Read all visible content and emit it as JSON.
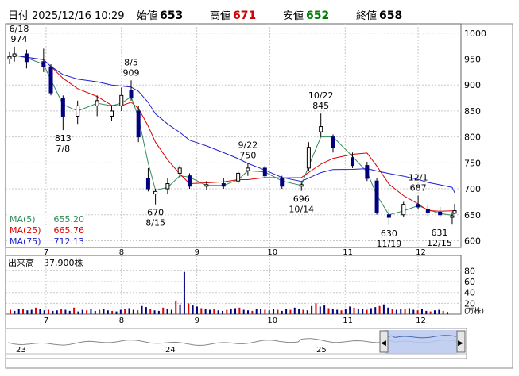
{
  "header": {
    "date_label": "日付",
    "datetime": "2025/12/16 10:29",
    "open_label": "始値",
    "open": "653",
    "high_label": "高値",
    "high": "671",
    "low_label": "安値",
    "low": "652",
    "close_label": "終値",
    "close": "658",
    "high_color": "#cc0000",
    "low_color": "#008000"
  },
  "price_panel": {
    "y_ticks": [
      "1000",
      "950",
      "900",
      "850",
      "800",
      "750",
      "700",
      "650",
      "600"
    ],
    "x_months": [
      "7",
      "8",
      "9",
      "10",
      "11",
      "12"
    ],
    "annotations": [
      {
        "date": "6/18",
        "value": "974"
      },
      {
        "date": "8/5",
        "value": "909"
      },
      {
        "date": "7/8",
        "value": "813"
      },
      {
        "date": "9/22",
        "value": "750"
      },
      {
        "date": "10/22",
        "value": "845"
      },
      {
        "date": "8/15",
        "value": "670"
      },
      {
        "date": "10/14",
        "value": "696"
      },
      {
        "date": "12/1",
        "value": "687"
      },
      {
        "date": "11/19",
        "value": "630"
      },
      {
        "date": "12/15",
        "value": "631"
      }
    ],
    "legend": [
      {
        "label": "MA(5)",
        "value": "655.20",
        "color": "#2e8b57"
      },
      {
        "label": "MA(25)",
        "value": "665.76",
        "color": "#e00000"
      },
      {
        "label": "MA(75)",
        "value": "712.13",
        "color": "#2020d0"
      }
    ]
  },
  "volume_panel": {
    "label": "出来高",
    "value": "37,900株",
    "y_ticks": [
      "80",
      "60",
      "40",
      "20"
    ],
    "unit": "(万株)"
  },
  "navigator": {
    "labels": [
      "23",
      "24",
      "25"
    ]
  },
  "colors": {
    "up_candle": "#ffffff",
    "down_candle": "#000080",
    "vol_up": "#e00000",
    "vol_down": "#000080",
    "grid": "#c8c8c8",
    "nav_fill": "#b8c8f0"
  },
  "chart_data": [
    {
      "type": "candlestick",
      "ylim": [
        590,
        1015
      ],
      "x_range": [
        "2025-06-16",
        "2025-12-16"
      ],
      "ohlc_weekly_approx": [
        {
          "d": "06-16",
          "o": 950,
          "h": 965,
          "l": 940,
          "c": 955
        },
        {
          "d": "06-18",
          "o": 955,
          "h": 974,
          "l": 945,
          "c": 960
        },
        {
          "d": "06-23",
          "o": 960,
          "h": 968,
          "l": 932,
          "c": 945
        },
        {
          "d": "06-30",
          "o": 945,
          "h": 970,
          "l": 925,
          "c": 935
        },
        {
          "d": "07-03",
          "o": 935,
          "h": 940,
          "l": 880,
          "c": 885
        },
        {
          "d": "07-08",
          "o": 875,
          "h": 880,
          "l": 813,
          "c": 840
        },
        {
          "d": "07-14",
          "o": 840,
          "h": 870,
          "l": 825,
          "c": 860
        },
        {
          "d": "07-22",
          "o": 860,
          "h": 880,
          "l": 840,
          "c": 870
        },
        {
          "d": "07-28",
          "o": 840,
          "h": 860,
          "l": 830,
          "c": 850
        },
        {
          "d": "08-01",
          "o": 860,
          "h": 895,
          "l": 850,
          "c": 880
        },
        {
          "d": "08-05",
          "o": 890,
          "h": 909,
          "l": 870,
          "c": 875
        },
        {
          "d": "08-08",
          "o": 850,
          "h": 860,
          "l": 790,
          "c": 800
        },
        {
          "d": "08-12",
          "o": 720,
          "h": 740,
          "l": 695,
          "c": 700
        },
        {
          "d": "08-15",
          "o": 690,
          "h": 700,
          "l": 670,
          "c": 695
        },
        {
          "d": "08-20",
          "o": 700,
          "h": 720,
          "l": 690,
          "c": 710
        },
        {
          "d": "08-25",
          "o": 730,
          "h": 745,
          "l": 720,
          "c": 740
        },
        {
          "d": "08-29",
          "o": 725,
          "h": 730,
          "l": 700,
          "c": 705
        },
        {
          "d": "09-05",
          "o": 705,
          "h": 715,
          "l": 698,
          "c": 708
        },
        {
          "d": "09-12",
          "o": 710,
          "h": 720,
          "l": 700,
          "c": 705
        },
        {
          "d": "09-18",
          "o": 715,
          "h": 735,
          "l": 710,
          "c": 730
        },
        {
          "d": "09-22",
          "o": 735,
          "h": 750,
          "l": 725,
          "c": 740
        },
        {
          "d": "09-29",
          "o": 740,
          "h": 745,
          "l": 720,
          "c": 725
        },
        {
          "d": "10-06",
          "o": 720,
          "h": 725,
          "l": 700,
          "c": 705
        },
        {
          "d": "10-14",
          "o": 705,
          "h": 712,
          "l": 696,
          "c": 708
        },
        {
          "d": "10-17",
          "o": 740,
          "h": 790,
          "l": 735,
          "c": 780
        },
        {
          "d": "10-22",
          "o": 810,
          "h": 845,
          "l": 800,
          "c": 820
        },
        {
          "d": "10-27",
          "o": 800,
          "h": 805,
          "l": 770,
          "c": 780
        },
        {
          "d": "11-04",
          "o": 760,
          "h": 770,
          "l": 740,
          "c": 745
        },
        {
          "d": "11-10",
          "o": 745,
          "h": 752,
          "l": 715,
          "c": 720
        },
        {
          "d": "11-14",
          "o": 715,
          "h": 720,
          "l": 650,
          "c": 655
        },
        {
          "d": "11-19",
          "o": 650,
          "h": 660,
          "l": 630,
          "c": 645
        },
        {
          "d": "11-25",
          "o": 650,
          "h": 675,
          "l": 645,
          "c": 670
        },
        {
          "d": "12-01",
          "o": 670,
          "h": 687,
          "l": 660,
          "c": 665
        },
        {
          "d": "12-05",
          "o": 660,
          "h": 668,
          "l": 648,
          "c": 655
        },
        {
          "d": "12-10",
          "o": 655,
          "h": 665,
          "l": 645,
          "c": 650
        },
        {
          "d": "12-15",
          "o": 645,
          "h": 655,
          "l": 631,
          "c": 648
        },
        {
          "d": "12-16",
          "o": 653,
          "h": 671,
          "l": 652,
          "c": 658
        }
      ],
      "ma": [
        {
          "label": "MA(5)",
          "last": 655.2
        },
        {
          "label": "MA(25)",
          "last": 665.76
        },
        {
          "label": "MA(75)",
          "last": 712.13
        }
      ]
    },
    {
      "type": "bar",
      "label": "出来高",
      "unit": "万株",
      "ylim": [
        0,
        85
      ],
      "values_approx": [
        8,
        6,
        10,
        9,
        7,
        8,
        12,
        9,
        7,
        8,
        6,
        7,
        10,
        8,
        6,
        12,
        5,
        8,
        7,
        9,
        6,
        8,
        10,
        7,
        6,
        5,
        8,
        9,
        11,
        8,
        7,
        15,
        13,
        9,
        7,
        6,
        12,
        9,
        8,
        24,
        18,
        78,
        20,
        16,
        14,
        11,
        9,
        8,
        10,
        7,
        6,
        8,
        9,
        11,
        12,
        8,
        7,
        6,
        9,
        10,
        8,
        7,
        9,
        8,
        6,
        9,
        8,
        12,
        9,
        8,
        7,
        15,
        20,
        14,
        16,
        11,
        9,
        8,
        7,
        10,
        14,
        12,
        10,
        9,
        8,
        11,
        13,
        15,
        18,
        12,
        9,
        8,
        10,
        9,
        11,
        8,
        7,
        9,
        6,
        5,
        7,
        8,
        6,
        4
      ]
    }
  ]
}
